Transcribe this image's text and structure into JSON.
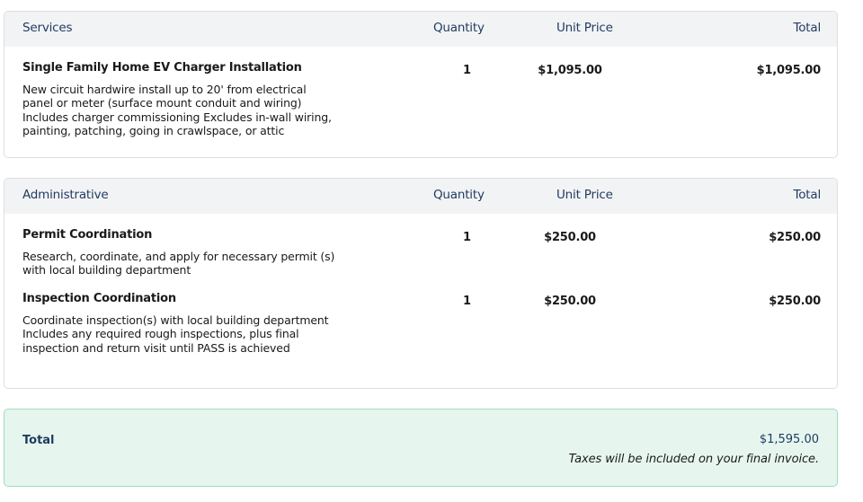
{
  "sections": [
    {
      "header": {
        "name": "Services",
        "quantity": "Quantity",
        "unit_price": "Unit Price",
        "total": "Total"
      },
      "items": [
        {
          "title": "Single Family Home EV Charger Installation",
          "description": "New circuit hardwire install up to 20' from electrical panel or meter (surface mount conduit and wiring) Includes charger commissioning Excludes in-wall wiring, painting, patching, going in crawlspace, or attic",
          "quantity": "1",
          "unit_price": "$1,095.00",
          "total": "$1,095.00"
        }
      ]
    },
    {
      "header": {
        "name": "Administrative",
        "quantity": "Quantity",
        "unit_price": "Unit Price",
        "total": "Total"
      },
      "items": [
        {
          "title": "Permit Coordination",
          "description": "Research, coordinate, and apply for necessary permit (s) with local building department",
          "quantity": "1",
          "unit_price": "$250.00",
          "total": "$250.00"
        },
        {
          "title": "Inspection Coordination",
          "description": "Coordinate inspection(s) with local building department Includes any required rough inspections, plus final inspection and return visit until PASS is achieved",
          "quantity": "1",
          "unit_price": "$250.00",
          "total": "$250.00"
        }
      ]
    }
  ],
  "summary": {
    "label": "Total",
    "amount": "$1,595.00",
    "note": "Taxes will be included on your final invoice."
  },
  "colors": {
    "header_bg": "#f2f3f5",
    "header_text": "#1f3a5f",
    "summary_bg": "#e6f6ef",
    "summary_border": "#9fdcbd"
  }
}
